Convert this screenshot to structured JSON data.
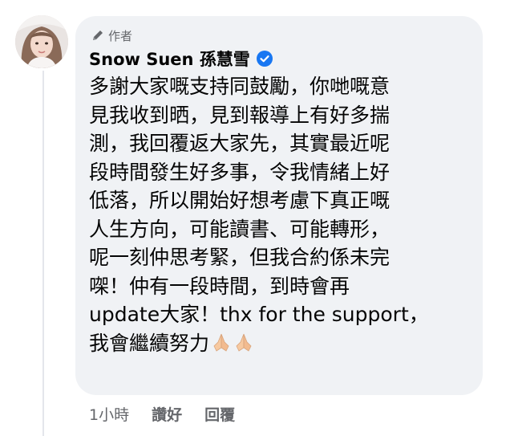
{
  "comment": {
    "badge_label": "作者",
    "author_name": "Snow Suen 孫慧雪",
    "text_lines": [
      "多謝大家嘅支持同鼓勵，你哋嘅意",
      "見我收到晒，見到報導上有好多揣",
      "測，我回覆返大家先，其實最近呢",
      "段時間發生好多事，令我情緒上好",
      "低落，所以開始好想考慮下真正嘅",
      "人生方向，可能讀書、可能轉形，",
      "呢一刻仲思考緊，但我合約係未完",
      "㗎！仲有一段時間，到時會再",
      "update大家！thx for the support，",
      "我會繼續努力"
    ],
    "emojis": [
      "folded-hands-icon",
      "folded-hands-icon"
    ],
    "timestamp": "1小時",
    "like_label": "讚好",
    "reply_label": "回覆"
  },
  "colors": {
    "bubble_bg": "#f0f2f5",
    "text": "#050505",
    "secondary": "#65676b",
    "verified_blue": "#1877f2"
  }
}
